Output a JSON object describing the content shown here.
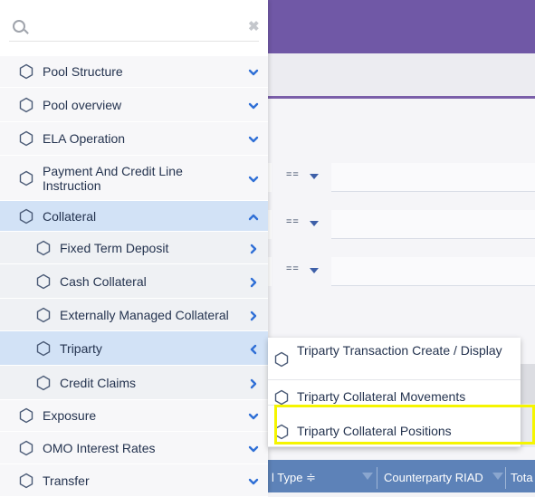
{
  "search": {
    "placeholder": "",
    "clear_glyph": "✖"
  },
  "icons": {
    "menu": "hexagon-icon",
    "search": "search-icon",
    "expand": "chevron-down-icon",
    "collapse": "chevron-up-icon",
    "submenu": "chevron-right-icon",
    "back": "chevron-left-icon"
  },
  "colors": {
    "header": "#7058a6",
    "active_item": "#d2e2f6",
    "chevron": "#2f6fd6",
    "highlight": "#f5f500",
    "table_header": "#5d82b8"
  },
  "menu": {
    "items": [
      {
        "label": "Pool Structure"
      },
      {
        "label": "Pool overview"
      },
      {
        "label": "ELA Operation"
      },
      {
        "label": "Payment And Credit Line Instruction"
      },
      {
        "label": "Collateral"
      },
      {
        "label": "Fixed Term Deposit"
      },
      {
        "label": "Cash Collateral"
      },
      {
        "label": "Externally Managed Collateral"
      },
      {
        "label": "Triparty"
      },
      {
        "label": "Credit Claims"
      },
      {
        "label": "Exposure"
      },
      {
        "label": "OMO Interest Rates"
      },
      {
        "label": "Transfer"
      }
    ]
  },
  "flyout": {
    "items": [
      {
        "label": "Triparty Transaction Create / Display"
      },
      {
        "label": "Triparty Collateral Movements"
      },
      {
        "label": "Triparty Collateral Positions"
      }
    ]
  },
  "filters": [
    {
      "operator": "=="
    },
    {
      "operator": "=="
    },
    {
      "operator": "=="
    }
  ],
  "table": {
    "columns": [
      "l Type ≑",
      "Counterparty RIAD",
      "Tota"
    ]
  }
}
